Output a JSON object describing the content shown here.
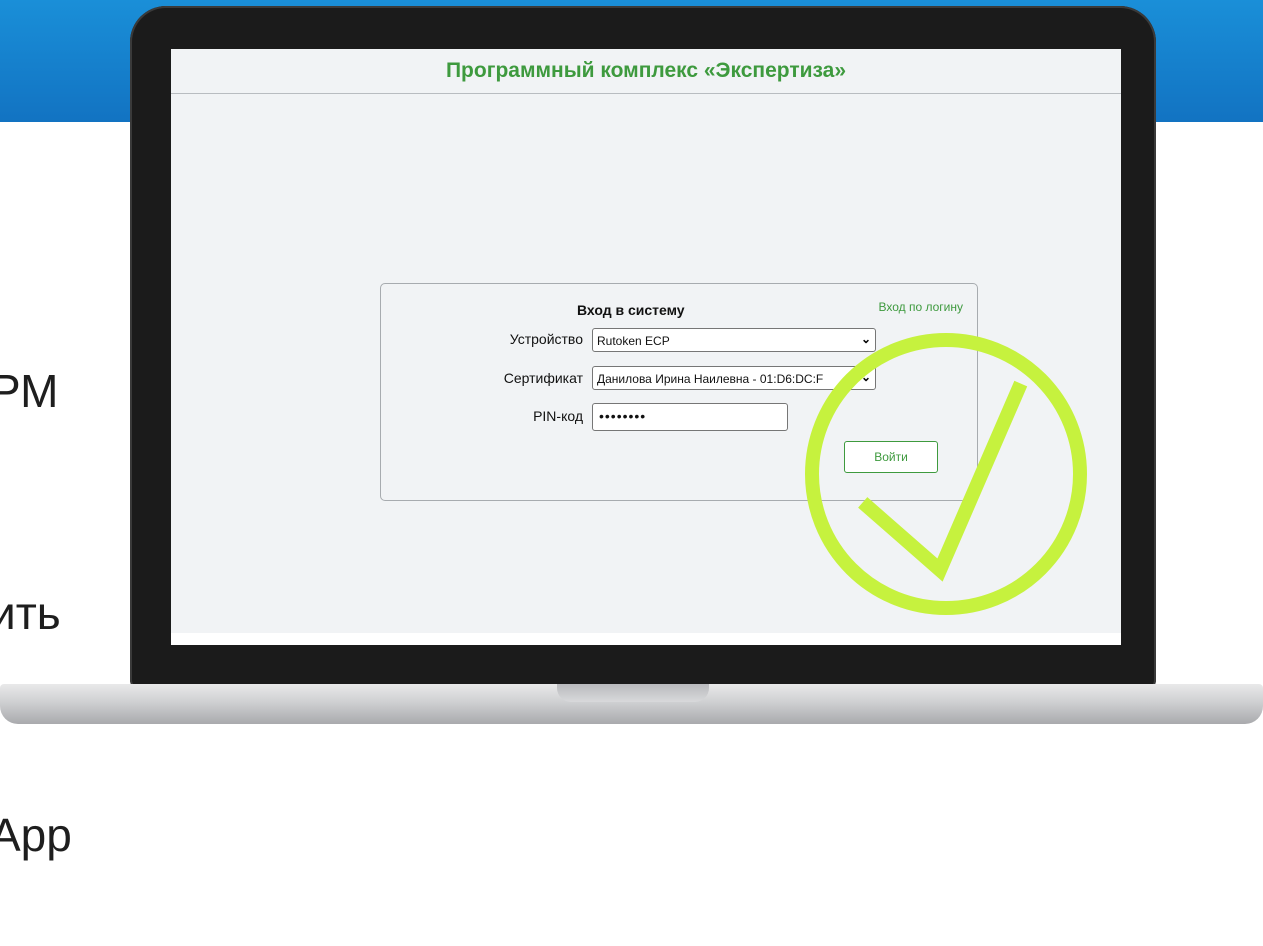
{
  "background": {
    "lines": [
      "РМ",
      "ить",
      "App"
    ],
    "accent_color": "#1a8fd8"
  },
  "app": {
    "title": "Программный комплекс «Экспертиза»",
    "title_color": "#3e9a3e"
  },
  "login": {
    "heading": "Вход в систему",
    "login_link": "Вход по логину",
    "device_label": "Устройство",
    "device_value": "Rutoken ECP",
    "certificate_label": "Сертификат",
    "certificate_value": "Данилова Ирина Наилевна - 01:D6:DC:F",
    "pin_label": "PIN-код",
    "pin_value": "••••••••",
    "submit_label": "Войти"
  },
  "overlay": {
    "icon": "checkmark-circle-icon",
    "color": "#c6f23e"
  }
}
